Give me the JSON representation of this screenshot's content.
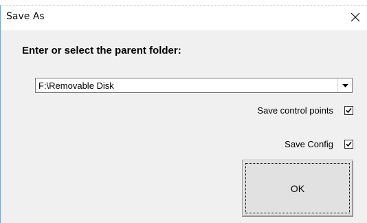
{
  "window": {
    "title": "Save As",
    "close_icon": "close-icon"
  },
  "dialog": {
    "heading": "Enter or select the parent folder:",
    "folder_combo": {
      "value": "F:\\Removable Disk",
      "dropdown_icon": "chevron-down-icon"
    },
    "options": [
      {
        "label": "Save control points",
        "checked": true
      },
      {
        "label": "Save Config",
        "checked": true
      }
    ],
    "ok_button": {
      "label": "OK"
    }
  },
  "colors": {
    "title_bar": "#ffffff",
    "client_bg": "#f0f0f0",
    "button_bg": "#e1e1e1",
    "window_edge": "#7a9fce"
  }
}
